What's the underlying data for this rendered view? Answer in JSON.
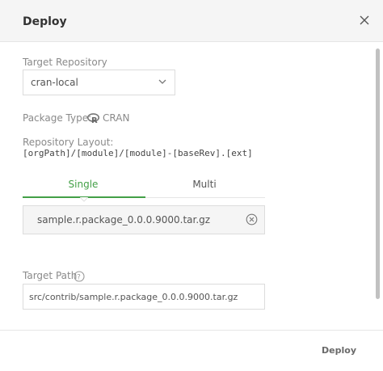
{
  "dialog": {
    "title": "Deploy",
    "close_icon": "close-icon"
  },
  "target_repository": {
    "label": "Target Repository",
    "value": "cran-local",
    "icon": "chevron-down-icon"
  },
  "package_type": {
    "label": "Package Type:",
    "value": "CRAN",
    "icon": "cran-r-icon"
  },
  "repository_layout": {
    "label": "Repository Layout:",
    "value": "[orgPath]/[module]/[module]-[baseRev].[ext]"
  },
  "tabs": [
    {
      "label": "Single",
      "active": true
    },
    {
      "label": "Multi",
      "active": false
    }
  ],
  "file": {
    "name": "sample.r.package_0.0.0.9000.tar.gz",
    "remove_icon": "remove-circle-icon"
  },
  "target_path": {
    "label": "Target Path",
    "help_icon": "help-circle-icon",
    "value": "src/contrib/sample.r.package_0.0.0.9000.tar.gz"
  },
  "footer": {
    "deploy_label": "Deploy"
  },
  "colors": {
    "accent": "#43a047",
    "header_bg": "#f5f5f5",
    "border": "#dcdcdc"
  }
}
